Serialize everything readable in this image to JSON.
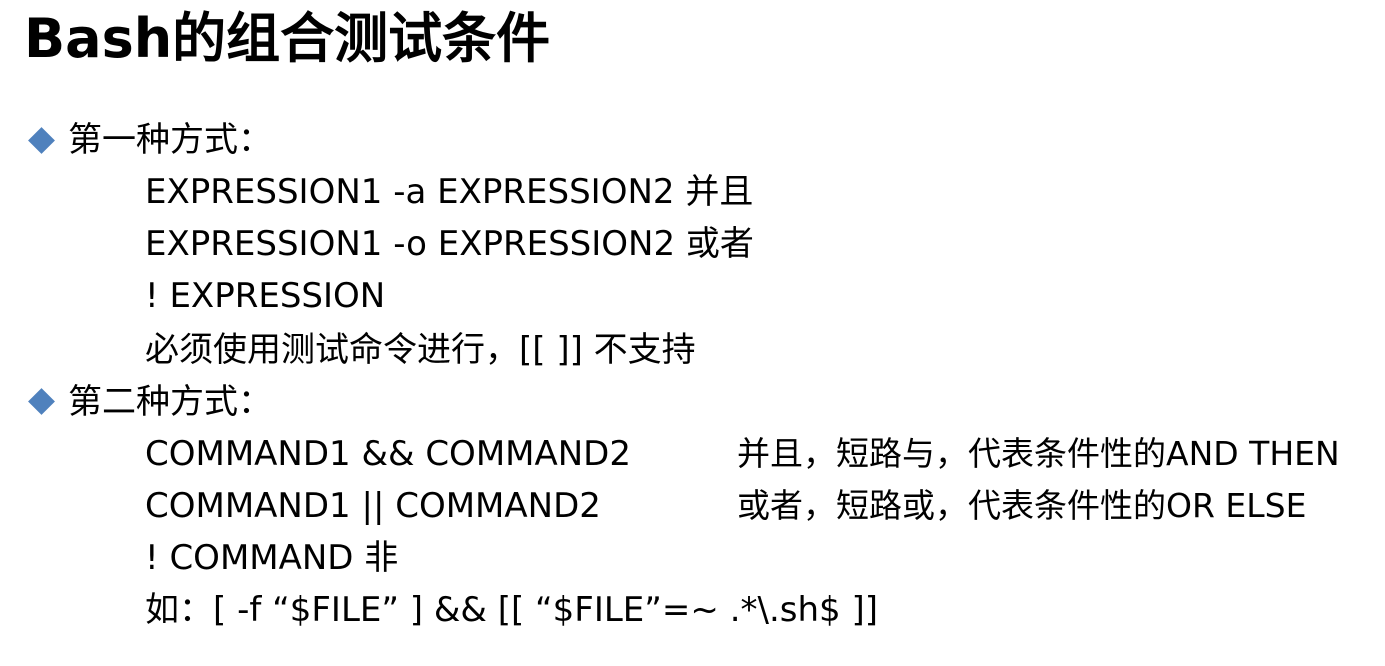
{
  "title": "Bash的组合测试条件",
  "accent_color": "#4f81bd",
  "bullet_icon": "diamond-bullet-icon",
  "sections": [
    {
      "heading": "第一种方式：",
      "lines": [
        "EXPRESSION1 -a EXPRESSION2 并且",
        "EXPRESSION1 -o EXPRESSION2 或者",
        "! EXPRESSION",
        "必须使用测试命令进行，[[ ]] 不支持"
      ]
    },
    {
      "heading": "第二种方式：",
      "rows": [
        {
          "command": "COMMAND1 && COMMAND2",
          "desc": "并且，短路与，代表条件性的AND  THEN"
        },
        {
          "command": "COMMAND1 || COMMAND2",
          "desc": "或者，短路或，代表条件性的OR  ELSE"
        }
      ],
      "lines": [
        "! COMMAND   非",
        "如：[ -f  “$FILE”  ] && [[  “$FILE”=~ .*\\.sh$  ]]"
      ]
    }
  ]
}
